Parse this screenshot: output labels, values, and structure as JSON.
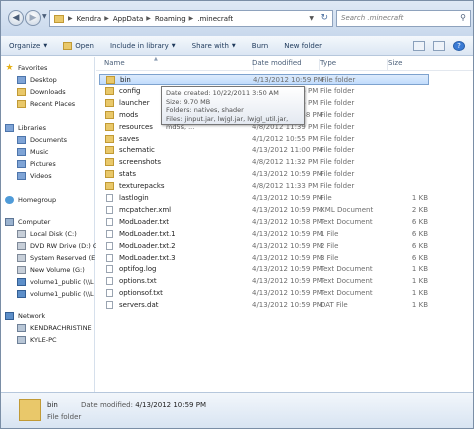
{
  "address": {
    "crumbs": [
      "Kendra",
      "AppData",
      "Roaming",
      ".minecraft"
    ],
    "search_placeholder": "Search .minecraft"
  },
  "toolbar": {
    "organize": "Organize",
    "open": "Open",
    "include": "Include in library",
    "share": "Share with",
    "burn": "Burn",
    "new_folder": "New folder"
  },
  "nav": {
    "favorites": "Favorites",
    "desktop": "Desktop",
    "downloads": "Downloads",
    "recent": "Recent Places",
    "libraries": "Libraries",
    "documents": "Documents",
    "music": "Music",
    "pictures": "Pictures",
    "videos": "Videos",
    "homegroup": "Homegroup",
    "computer": "Computer",
    "drives": [
      "Local Disk (C:)",
      "DVD RW Drive (D:) G",
      "System Reserved (E:)",
      "New Volume (G:)",
      "volume1_public (\\\\L",
      "volume1_public (\\\\L"
    ],
    "network": "Network",
    "net_items": [
      "KENDRACHRISTINE",
      "KYLE-PC"
    ]
  },
  "columns": {
    "name": "Name",
    "date": "Date modified",
    "type": "Type",
    "size": "Size"
  },
  "files": [
    {
      "name": "bin",
      "date": "4/13/2012 10:59 PM",
      "type": "File folder",
      "size": "",
      "kind": "folder"
    },
    {
      "name": "config",
      "date": "4/8/2012 11:35 PM",
      "type": "File folder",
      "size": "",
      "kind": "folder"
    },
    {
      "name": "launcher",
      "date": "4/8/2012 11:35 PM",
      "type": "File folder",
      "size": "",
      "kind": "folder"
    },
    {
      "name": "mods",
      "date": "4/13/2012 10:58 PM",
      "type": "File folder",
      "size": "",
      "kind": "folder"
    },
    {
      "name": "resources",
      "date": "4/8/2012 11:39 PM",
      "type": "File folder",
      "size": "",
      "kind": "folder"
    },
    {
      "name": "saves",
      "date": "4/1/2012 10:55 PM",
      "type": "File folder",
      "size": "",
      "kind": "folder"
    },
    {
      "name": "schematic",
      "date": "4/13/2012 11:00 PM",
      "type": "File folder",
      "size": "",
      "kind": "folder"
    },
    {
      "name": "screenshots",
      "date": "4/8/2012 11:32 PM",
      "type": "File folder",
      "size": "",
      "kind": "folder"
    },
    {
      "name": "stats",
      "date": "4/13/2012 10:59 PM",
      "type": "File folder",
      "size": "",
      "kind": "folder"
    },
    {
      "name": "texturepacks",
      "date": "4/8/2012 11:33 PM",
      "type": "File folder",
      "size": "",
      "kind": "folder"
    },
    {
      "name": "lastlogin",
      "date": "4/13/2012 10:59 PM",
      "type": "File",
      "size": "1 KB",
      "kind": "file"
    },
    {
      "name": "mcpatcher.xml",
      "date": "4/13/2012 10:59 PM",
      "type": "XML Document",
      "size": "2 KB",
      "kind": "file"
    },
    {
      "name": "ModLoader.txt",
      "date": "4/13/2012 10:58 PM",
      "type": "Text Document",
      "size": "6 KB",
      "kind": "file"
    },
    {
      "name": "ModLoader.txt.1",
      "date": "4/13/2012 10:59 PM",
      "type": "1 File",
      "size": "6 KB",
      "kind": "file"
    },
    {
      "name": "ModLoader.txt.2",
      "date": "4/13/2012 10:59 PM",
      "type": "2 File",
      "size": "6 KB",
      "kind": "file"
    },
    {
      "name": "ModLoader.txt.3",
      "date": "4/13/2012 10:59 PM",
      "type": "3 File",
      "size": "6 KB",
      "kind": "file"
    },
    {
      "name": "optifog.log",
      "date": "4/13/2012 10:59 PM",
      "type": "Text Document",
      "size": "1 KB",
      "kind": "file"
    },
    {
      "name": "options.txt",
      "date": "4/13/2012 10:59 PM",
      "type": "Text Document",
      "size": "1 KB",
      "kind": "file"
    },
    {
      "name": "optionsof.txt",
      "date": "4/13/2012 10:59 PM",
      "type": "Text Document",
      "size": "1 KB",
      "kind": "file"
    },
    {
      "name": "servers.dat",
      "date": "4/13/2012 10:59 PM",
      "type": "DAT File",
      "size": "1 KB",
      "kind": "file"
    }
  ],
  "tooltip": {
    "line1": "Date created: 10/22/2011 3:50 AM",
    "line2": "Size: 9.70 MB",
    "line3": "Folders: natives, shader",
    "line4": "Files: jinput.jar, lwjgl.jar, lwjgl_util.jar, md5s, ..."
  },
  "details": {
    "name": "bin",
    "type": "File folder",
    "date_label": "Date modified:",
    "date_value": "4/13/2012 10:59 PM"
  }
}
